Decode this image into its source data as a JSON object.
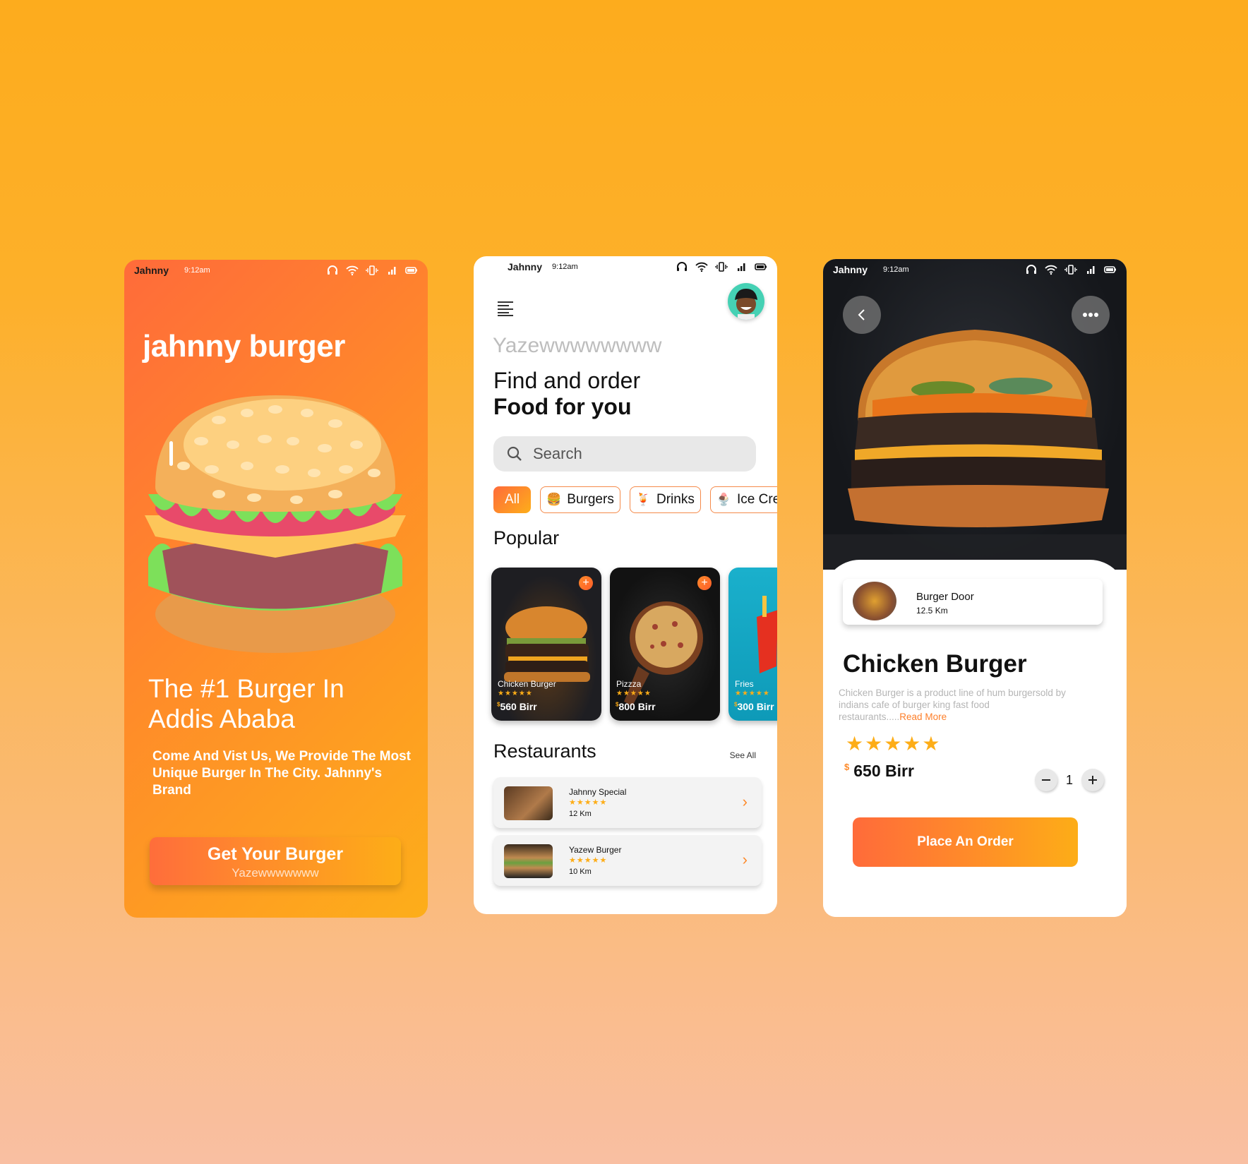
{
  "status_bar": {
    "carrier": "Jahnny",
    "time": "9:12am"
  },
  "splash": {
    "brand": "jahnny burger",
    "headline_line1": "The #1 Burger In",
    "headline_line2": "Addis Ababa",
    "description": "Come And Vist Us, We Provide The Most Unique Burger In The City. Jahnny's Brand",
    "cta_label": "Get Your Burger",
    "cta_sub": "Yazewwwwwww"
  },
  "home": {
    "greeting": "Yazewwwwwwww",
    "title_line1": "Find and order",
    "title_line2": "Food for you",
    "search_placeholder": "Search",
    "categories": [
      {
        "label": "All",
        "emoji": "",
        "active": true
      },
      {
        "label": "Burgers",
        "emoji": "🍔",
        "active": false
      },
      {
        "label": "Drinks",
        "emoji": "🍹",
        "active": false
      },
      {
        "label": "Ice Cream",
        "emoji": "🍨",
        "active": false
      }
    ],
    "popular_title": "Popular",
    "popular": [
      {
        "name": "Chicken Burger",
        "rating": 5,
        "currency": "$",
        "price": "560 Birr"
      },
      {
        "name": "Pizzza",
        "rating": 5,
        "currency": "$",
        "price": "800 Birr"
      },
      {
        "name": "Fries",
        "rating": 5,
        "currency": "$",
        "price": "300 Birr"
      }
    ],
    "restaurants_title": "Restaurants",
    "see_all": "See All",
    "restaurants": [
      {
        "name": "Jahnny Special",
        "rating": 5,
        "distance": "12 Km"
      },
      {
        "name": "Yazew Burger",
        "rating": 5,
        "distance": "10 Km"
      }
    ]
  },
  "detail": {
    "shop_name": "Burger Door",
    "shop_distance": "12.5 Km",
    "title": "Chicken Burger",
    "description": "Chicken Burger is a product line of hum burgersold by indians cafe of burger king fast food restaurants.....",
    "read_more": "Read More",
    "rating": 5,
    "currency": "$",
    "price": "650 Birr",
    "quantity": "1",
    "order_label": "Place An Order"
  },
  "stars_text": "★★★★★",
  "colors": {
    "accent_start": "#ff6b3a",
    "accent_end": "#fdad17",
    "star": "#fdad17"
  }
}
